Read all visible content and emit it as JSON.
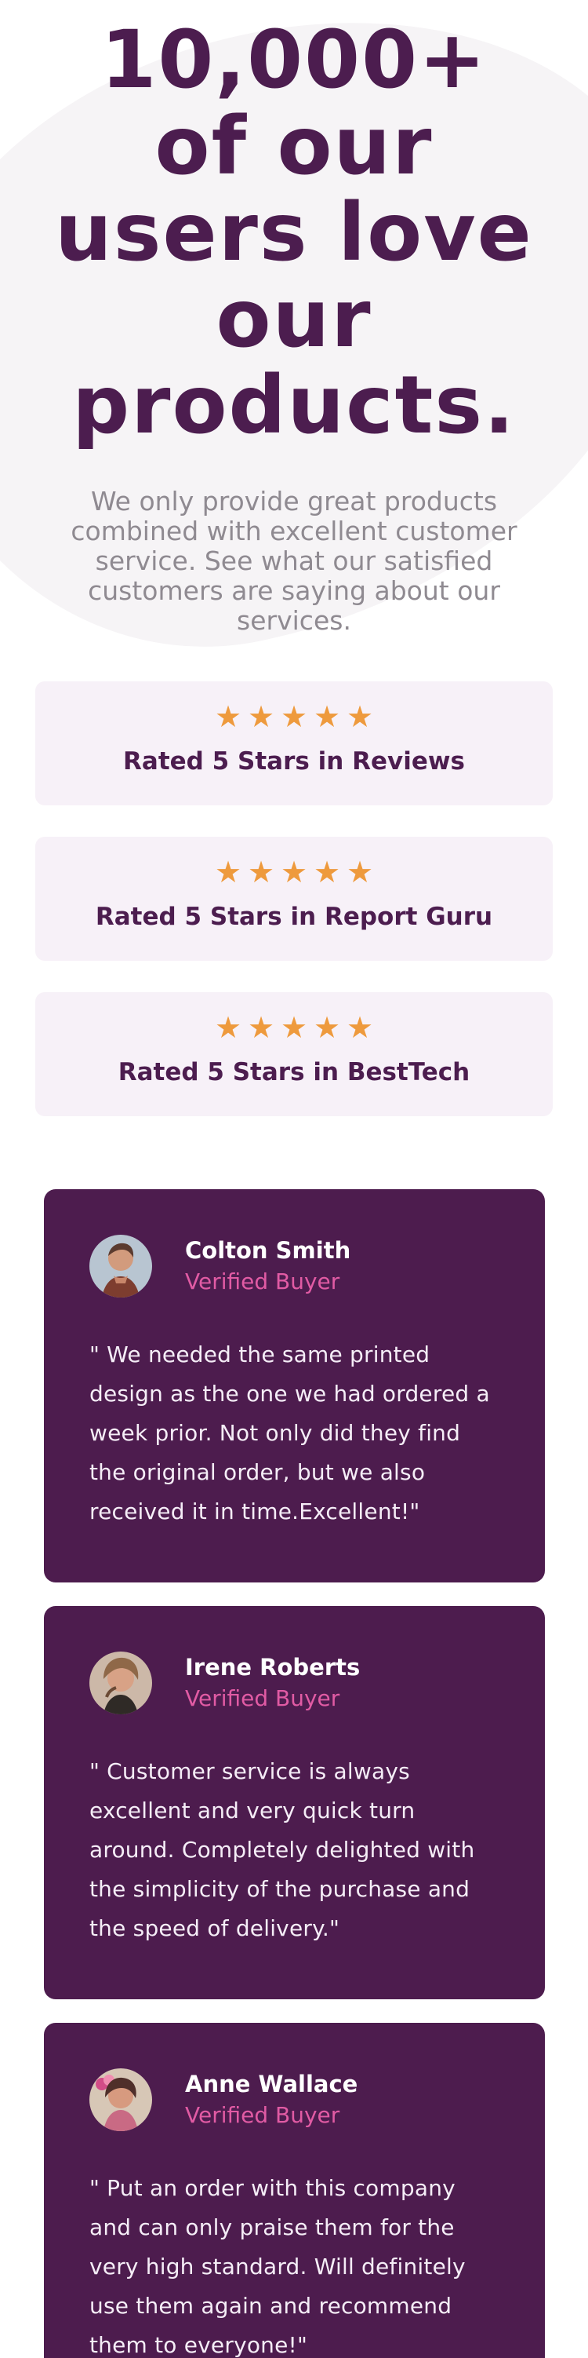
{
  "hero": {
    "title": "10,000+ of our users love our products.",
    "subtitle": "We only provide great products combined with excellent customer service. See what our satisfied customers are saying about our services."
  },
  "ratings": [
    {
      "stars": 5,
      "label": "Rated 5 Stars in Reviews"
    },
    {
      "stars": 5,
      "label": "Rated 5 Stars in Report Guru"
    },
    {
      "stars": 5,
      "label": "Rated 5 Stars in BestTech"
    }
  ],
  "testimonials": [
    {
      "name": "Colton Smith",
      "role": "Verified Buyer",
      "quote": "\" We needed the same printed design as the one we had ordered a week prior. Not only did they find the original order, but we also received it in time.Excellent!\""
    },
    {
      "name": "Irene Roberts",
      "role": "Verified Buyer",
      "quote": "\" Customer service is always excellent and very quick turn around. Completely delighted with the simplicity of the purchase and the speed of delivery.\""
    },
    {
      "name": "Anne Wallace",
      "role": "Verified Buyer",
      "quote": "\" Put an order with this company and can only praise them for the very high standard. Will definitely use them again and recommend them to everyone!\""
    }
  ],
  "colors": {
    "brand": "#4c1d4f",
    "accent": "#e15ba4",
    "star": "#ee9a3d",
    "card_bg": "#f7f1f8",
    "testimonial_bg": "#4d1c4e"
  },
  "icons": {
    "star": "star-icon",
    "avatar": "avatar"
  }
}
